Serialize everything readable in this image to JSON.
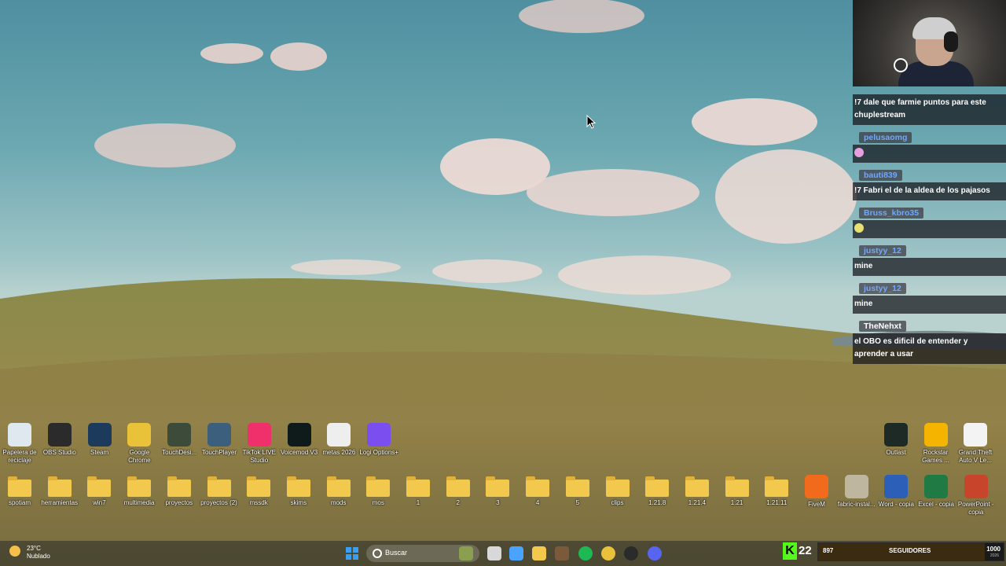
{
  "chat": [
    {
      "user": "",
      "text": "!7 dale que farmie puntos para este chuplestream",
      "style": "msg"
    },
    {
      "user": "pelusaomg",
      "text": "",
      "emote": "#e6a0e0"
    },
    {
      "user": "bauti839",
      "text": "!7 Fabri el de la aldea de los pajasos"
    },
    {
      "user": "Bruss_kbro35",
      "text": "",
      "emote": "#e8e070"
    },
    {
      "user": "justyy_12",
      "text": "mine"
    },
    {
      "user": "justyy_12",
      "text": "mine"
    },
    {
      "user": "TheNehxt",
      "text": "el OBO es dificil de entender y aprender a usar",
      "white": true
    }
  ],
  "desktop_icons_top": [
    {
      "label": "Papelera de reciclaje",
      "icon": "recycle-bin-icon",
      "color": "#dfe8ef"
    },
    {
      "label": "OBS Studio",
      "icon": "obs-icon",
      "color": "#2b2b2b"
    },
    {
      "label": "Steam",
      "icon": "steam-icon",
      "color": "#1b3a5c"
    },
    {
      "label": "Google Chrome",
      "icon": "chrome-icon",
      "color": "#e9c23a"
    },
    {
      "label": "TouchDesi...",
      "icon": "touchdesigner-icon",
      "color": "#3d4b3a"
    },
    {
      "label": "TouchPlayer",
      "icon": "touchplayer-icon",
      "color": "#3b5f7d"
    },
    {
      "label": "TikTok LIVE Studio",
      "icon": "tiktok-icon",
      "color": "#f0306a"
    },
    {
      "label": "Voicemod V3",
      "icon": "voicemod-icon",
      "color": "#0f1a1a"
    },
    {
      "label": "metas 2026",
      "icon": "document-icon",
      "color": "#eeeeee"
    },
    {
      "label": "Logi Options+",
      "icon": "logi-icon",
      "color": "#7b4ef0"
    }
  ],
  "desktop_icons_top_right": [
    {
      "label": "Outlast",
      "icon": "outlast-icon",
      "color": "#1e2a26"
    },
    {
      "label": "Rockstar Games ...",
      "icon": "rockstar-icon",
      "color": "#f5b400"
    },
    {
      "label": "Grand Theft Auto V Le...",
      "icon": "document-icon",
      "color": "#f3f3f3"
    }
  ],
  "desktop_icons_bottom": [
    {
      "label": "spotiam",
      "kind": "folder"
    },
    {
      "label": "herramientas",
      "kind": "folder"
    },
    {
      "label": "win7",
      "kind": "folder"
    },
    {
      "label": "multimedia",
      "kind": "folder"
    },
    {
      "label": "proyectos",
      "kind": "folder"
    },
    {
      "label": "proyectos (2)",
      "kind": "folder"
    },
    {
      "label": "mssdk",
      "kind": "folder"
    },
    {
      "label": "skims",
      "kind": "folder"
    },
    {
      "label": "mods",
      "kind": "folder"
    },
    {
      "label": "mos",
      "kind": "folder"
    },
    {
      "label": "1",
      "kind": "folder"
    },
    {
      "label": "2",
      "kind": "folder"
    },
    {
      "label": "3",
      "kind": "folder"
    },
    {
      "label": "4",
      "kind": "folder"
    },
    {
      "label": "5",
      "kind": "folder"
    },
    {
      "label": "clips",
      "kind": "folder"
    },
    {
      "label": "1.21.8",
      "kind": "folder"
    },
    {
      "label": "1.21.4",
      "kind": "folder"
    },
    {
      "label": "1.21",
      "kind": "folder"
    },
    {
      "label": "1.21.11",
      "kind": "folder"
    },
    {
      "label": "FiveM",
      "kind": "app",
      "color": "#f26a1b",
      "icon": "fivem-icon"
    },
    {
      "label": "fabric-instal...",
      "kind": "app",
      "color": "#bfb6a0",
      "icon": "fabric-icon"
    },
    {
      "label": "Word - copia",
      "kind": "app",
      "color": "#2b5fb8",
      "icon": "word-icon"
    },
    {
      "label": "Excel - copia",
      "kind": "app",
      "color": "#1f7a43",
      "icon": "excel-icon"
    },
    {
      "label": "PowerPoint - copia",
      "kind": "app",
      "color": "#c8452c",
      "icon": "powerpoint-icon"
    }
  ],
  "taskbar": {
    "temperature": "23°C",
    "condition": "Nublado",
    "search_placeholder": "Buscar",
    "apps": [
      {
        "icon": "widgets-icon",
        "color": "#8aa050"
      },
      {
        "icon": "task-view-icon",
        "color": "#d8d8d8"
      },
      {
        "icon": "copilot-icon",
        "color": "#4aa3ff"
      },
      {
        "icon": "file-explorer-icon",
        "color": "#f2c94c"
      },
      {
        "icon": "game-icon",
        "color": "#7a5a3a"
      },
      {
        "icon": "spotify-icon",
        "color": "#1db954"
      },
      {
        "icon": "chrome-icon",
        "color": "#e9c23a"
      },
      {
        "icon": "obs-icon",
        "color": "#2b2b2b"
      },
      {
        "icon": "discord-icon",
        "color": "#5865f2"
      }
    ]
  },
  "stream_overlay": {
    "kick_logo": "K",
    "viewer_count": "22",
    "followers_current": "897",
    "followers_label": "SEGUIDORES",
    "followers_goal": "1000",
    "followers_progress": 0.897,
    "goal_year": "2026"
  }
}
